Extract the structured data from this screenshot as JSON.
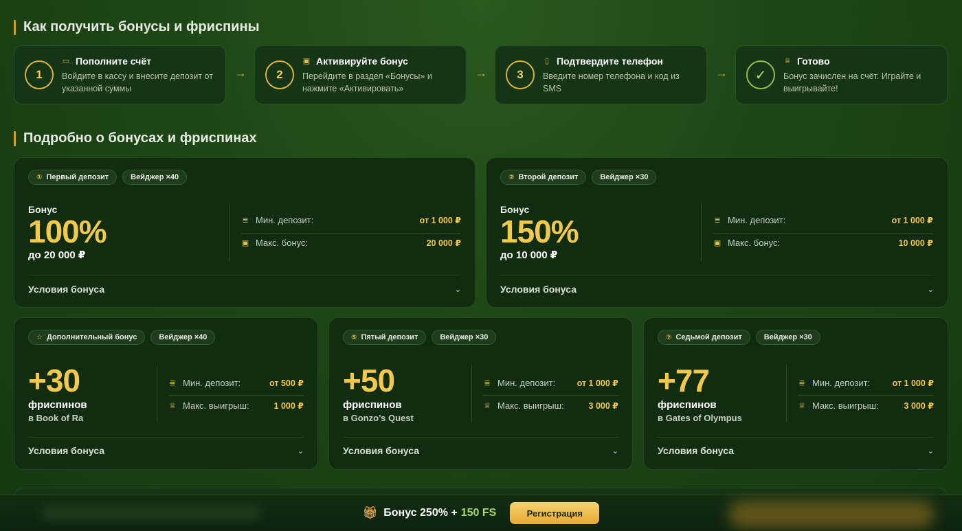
{
  "sections": {
    "how_to": "Как получить бонусы и фриспины",
    "details": "Подробно о бонусах и фриспинах"
  },
  "steps": [
    {
      "num": "1",
      "icon": "card-icon",
      "title": "Пополните счёт",
      "desc": "Войдите в кассу и внесите депозит от указанной суммы"
    },
    {
      "num": "2",
      "icon": "gift-icon",
      "title": "Активируйте бонус",
      "desc": "Перейдите в раздел «Бонусы» и нажмите «Активировать»"
    },
    {
      "num": "3",
      "icon": "phone-icon",
      "title": "Подтвердите телефон",
      "desc": "Введите номер телефона и код из SMS"
    },
    {
      "num": "✓",
      "icon": "trophy-icon",
      "title": "Готово",
      "desc": "Бонус зачислен на счёт. Играйте и выигрывайте!"
    }
  ],
  "bonus_cards": [
    {
      "tag": "Первый депозит",
      "wager": "Вейджер ×40",
      "label": "Бонус",
      "big": "100%",
      "sub": "до 20 000 ₽",
      "row1_label": "Мин. депозит:",
      "row1_value": "от 1 000 ₽",
      "row2_label": "Макс. бонус:",
      "row2_value": "20 000 ₽",
      "conditions": "Условия бонуса"
    },
    {
      "tag": "Второй депозит",
      "wager": "Вейджер ×30",
      "label": "Бонус",
      "big": "150%",
      "sub": "до 10 000 ₽",
      "row1_label": "Мин. депозит:",
      "row1_value": "от 1 000 ₽",
      "row2_label": "Макс. бонус:",
      "row2_value": "10 000 ₽",
      "conditions": "Условия бонуса"
    }
  ],
  "fs_cards": [
    {
      "tag": "Дополнительный бонус",
      "tag_icon": "star-icon",
      "wager": "Вейджер ×40",
      "big": "+30",
      "sub": "фриспинов",
      "game": "в Book of Ra",
      "row1_label": "Мин. депозит:",
      "row1_value": "от 500 ₽",
      "row2_label": "Макс. выигрыш:",
      "row2_value": "1 000 ₽",
      "conditions": "Условия бонуса"
    },
    {
      "tag": "Пятый депозит",
      "tag_icon": "five-icon",
      "wager": "Вейджер ×30",
      "big": "+50",
      "sub": "фриспинов",
      "game": "в Gonzo’s Quest",
      "row1_label": "Мин. депозит:",
      "row1_value": "от 1 000 ₽",
      "row2_label": "Макс. выигрыш:",
      "row2_value": "3 000 ₽",
      "conditions": "Условия бонуса"
    },
    {
      "tag": "Седьмой депозит",
      "tag_icon": "seven-icon",
      "wager": "Вейджер ×30",
      "big": "+77",
      "sub": "фриспинов",
      "game": "в Gates of Olympus",
      "row1_label": "Мин. депозит:",
      "row1_value": "от 1 000 ₽",
      "row2_label": "Макс. выигрыш:",
      "row2_value": "3 000 ₽",
      "conditions": "Условия бонуса"
    }
  ],
  "bottom_bar": {
    "promo_text": "Бонус 250% +",
    "promo_fs": "150 FS",
    "register_label": "Регистрация"
  },
  "colors": {
    "accent_gold": "#f2c94c",
    "background": "#1e4616",
    "card": "#122c12"
  }
}
